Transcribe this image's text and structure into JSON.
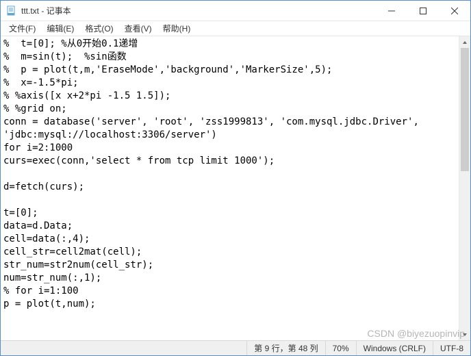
{
  "window": {
    "title": "ttt.txt - 记事本"
  },
  "menu": {
    "file": "文件(F)",
    "edit": "编辑(E)",
    "format": "格式(O)",
    "view": "查看(V)",
    "help": "帮助(H)"
  },
  "editor": {
    "content": "%  t=[0]; %从0开始0.1递增\n%  m=sin(t);  %sin函数\n%  p = plot(t,m,'EraseMode','background','MarkerSize',5);\n%  x=-1.5*pi;\n% %axis([x x+2*pi -1.5 1.5]);\n% %grid on;\nconn = database('server', 'root', 'zss1999813', 'com.mysql.jdbc.Driver', \n'jdbc:mysql://localhost:3306/server')\nfor i=2:1000\ncurs=exec(conn,'select * from tcp limit 1000');\n\nd=fetch(curs);\n\nt=[0];\ndata=d.Data;\ncell=data(:,4);\ncell_str=cell2mat(cell);\nstr_num=str2num(cell_str);\nnum=str_num(:,1);\n% for i=1:100\np = plot(t,num);"
  },
  "status": {
    "position": "第 9 行，第 48 列",
    "zoom": "70%",
    "line_ending": "Windows (CRLF)",
    "encoding": "UTF-8"
  },
  "watermark": "CSDN @biyezuopinvip"
}
